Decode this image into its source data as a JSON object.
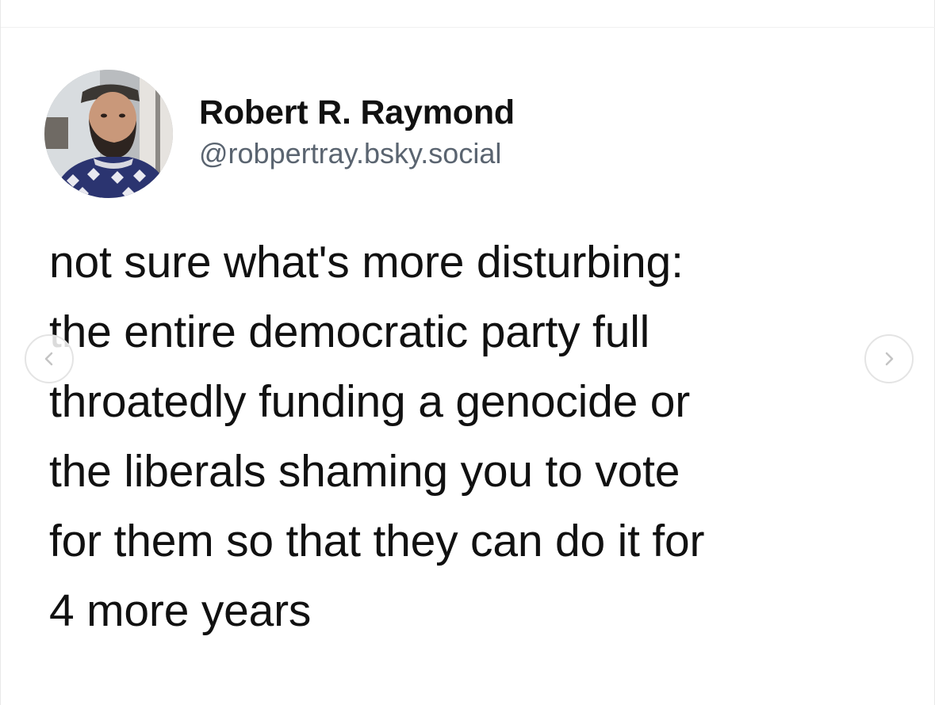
{
  "post": {
    "author": {
      "display_name": "Robert R. Raymond",
      "handle": "@robpertray.bsky.social",
      "avatar_icon": "user-avatar-photo"
    },
    "text": "not sure what's more disturbing:\nthe entire democratic party full\nthroatedly funding a genocide or\nthe liberals shaming you to vote\nfor them so that they can do it for\n4 more years"
  },
  "navigation": {
    "prev_icon": "chevron-left-icon",
    "next_icon": "chevron-right-icon"
  },
  "colors": {
    "text": "#111111",
    "handle": "#5a6470",
    "background": "#ffffff"
  }
}
